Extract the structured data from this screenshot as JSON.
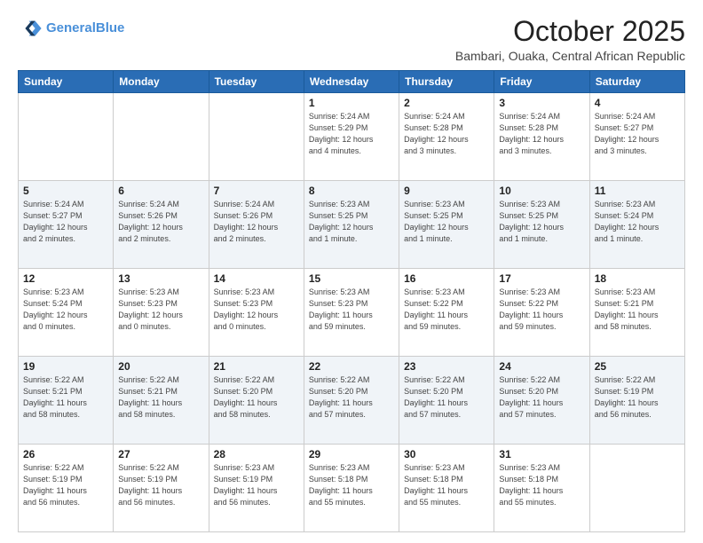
{
  "header": {
    "logo_line1": "General",
    "logo_line2": "Blue",
    "month": "October 2025",
    "location": "Bambari, Ouaka, Central African Republic"
  },
  "days_of_week": [
    "Sunday",
    "Monday",
    "Tuesday",
    "Wednesday",
    "Thursday",
    "Friday",
    "Saturday"
  ],
  "weeks": [
    [
      {
        "day": "",
        "info": ""
      },
      {
        "day": "",
        "info": ""
      },
      {
        "day": "",
        "info": ""
      },
      {
        "day": "1",
        "info": "Sunrise: 5:24 AM\nSunset: 5:29 PM\nDaylight: 12 hours\nand 4 minutes."
      },
      {
        "day": "2",
        "info": "Sunrise: 5:24 AM\nSunset: 5:28 PM\nDaylight: 12 hours\nand 3 minutes."
      },
      {
        "day": "3",
        "info": "Sunrise: 5:24 AM\nSunset: 5:28 PM\nDaylight: 12 hours\nand 3 minutes."
      },
      {
        "day": "4",
        "info": "Sunrise: 5:24 AM\nSunset: 5:27 PM\nDaylight: 12 hours\nand 3 minutes."
      }
    ],
    [
      {
        "day": "5",
        "info": "Sunrise: 5:24 AM\nSunset: 5:27 PM\nDaylight: 12 hours\nand 2 minutes."
      },
      {
        "day": "6",
        "info": "Sunrise: 5:24 AM\nSunset: 5:26 PM\nDaylight: 12 hours\nand 2 minutes."
      },
      {
        "day": "7",
        "info": "Sunrise: 5:24 AM\nSunset: 5:26 PM\nDaylight: 12 hours\nand 2 minutes."
      },
      {
        "day": "8",
        "info": "Sunrise: 5:23 AM\nSunset: 5:25 PM\nDaylight: 12 hours\nand 1 minute."
      },
      {
        "day": "9",
        "info": "Sunrise: 5:23 AM\nSunset: 5:25 PM\nDaylight: 12 hours\nand 1 minute."
      },
      {
        "day": "10",
        "info": "Sunrise: 5:23 AM\nSunset: 5:25 PM\nDaylight: 12 hours\nand 1 minute."
      },
      {
        "day": "11",
        "info": "Sunrise: 5:23 AM\nSunset: 5:24 PM\nDaylight: 12 hours\nand 1 minute."
      }
    ],
    [
      {
        "day": "12",
        "info": "Sunrise: 5:23 AM\nSunset: 5:24 PM\nDaylight: 12 hours\nand 0 minutes."
      },
      {
        "day": "13",
        "info": "Sunrise: 5:23 AM\nSunset: 5:23 PM\nDaylight: 12 hours\nand 0 minutes."
      },
      {
        "day": "14",
        "info": "Sunrise: 5:23 AM\nSunset: 5:23 PM\nDaylight: 12 hours\nand 0 minutes."
      },
      {
        "day": "15",
        "info": "Sunrise: 5:23 AM\nSunset: 5:23 PM\nDaylight: 11 hours\nand 59 minutes."
      },
      {
        "day": "16",
        "info": "Sunrise: 5:23 AM\nSunset: 5:22 PM\nDaylight: 11 hours\nand 59 minutes."
      },
      {
        "day": "17",
        "info": "Sunrise: 5:23 AM\nSunset: 5:22 PM\nDaylight: 11 hours\nand 59 minutes."
      },
      {
        "day": "18",
        "info": "Sunrise: 5:23 AM\nSunset: 5:21 PM\nDaylight: 11 hours\nand 58 minutes."
      }
    ],
    [
      {
        "day": "19",
        "info": "Sunrise: 5:22 AM\nSunset: 5:21 PM\nDaylight: 11 hours\nand 58 minutes."
      },
      {
        "day": "20",
        "info": "Sunrise: 5:22 AM\nSunset: 5:21 PM\nDaylight: 11 hours\nand 58 minutes."
      },
      {
        "day": "21",
        "info": "Sunrise: 5:22 AM\nSunset: 5:20 PM\nDaylight: 11 hours\nand 58 minutes."
      },
      {
        "day": "22",
        "info": "Sunrise: 5:22 AM\nSunset: 5:20 PM\nDaylight: 11 hours\nand 57 minutes."
      },
      {
        "day": "23",
        "info": "Sunrise: 5:22 AM\nSunset: 5:20 PM\nDaylight: 11 hours\nand 57 minutes."
      },
      {
        "day": "24",
        "info": "Sunrise: 5:22 AM\nSunset: 5:20 PM\nDaylight: 11 hours\nand 57 minutes."
      },
      {
        "day": "25",
        "info": "Sunrise: 5:22 AM\nSunset: 5:19 PM\nDaylight: 11 hours\nand 56 minutes."
      }
    ],
    [
      {
        "day": "26",
        "info": "Sunrise: 5:22 AM\nSunset: 5:19 PM\nDaylight: 11 hours\nand 56 minutes."
      },
      {
        "day": "27",
        "info": "Sunrise: 5:22 AM\nSunset: 5:19 PM\nDaylight: 11 hours\nand 56 minutes."
      },
      {
        "day": "28",
        "info": "Sunrise: 5:23 AM\nSunset: 5:19 PM\nDaylight: 11 hours\nand 56 minutes."
      },
      {
        "day": "29",
        "info": "Sunrise: 5:23 AM\nSunset: 5:18 PM\nDaylight: 11 hours\nand 55 minutes."
      },
      {
        "day": "30",
        "info": "Sunrise: 5:23 AM\nSunset: 5:18 PM\nDaylight: 11 hours\nand 55 minutes."
      },
      {
        "day": "31",
        "info": "Sunrise: 5:23 AM\nSunset: 5:18 PM\nDaylight: 11 hours\nand 55 minutes."
      },
      {
        "day": "",
        "info": ""
      }
    ]
  ]
}
